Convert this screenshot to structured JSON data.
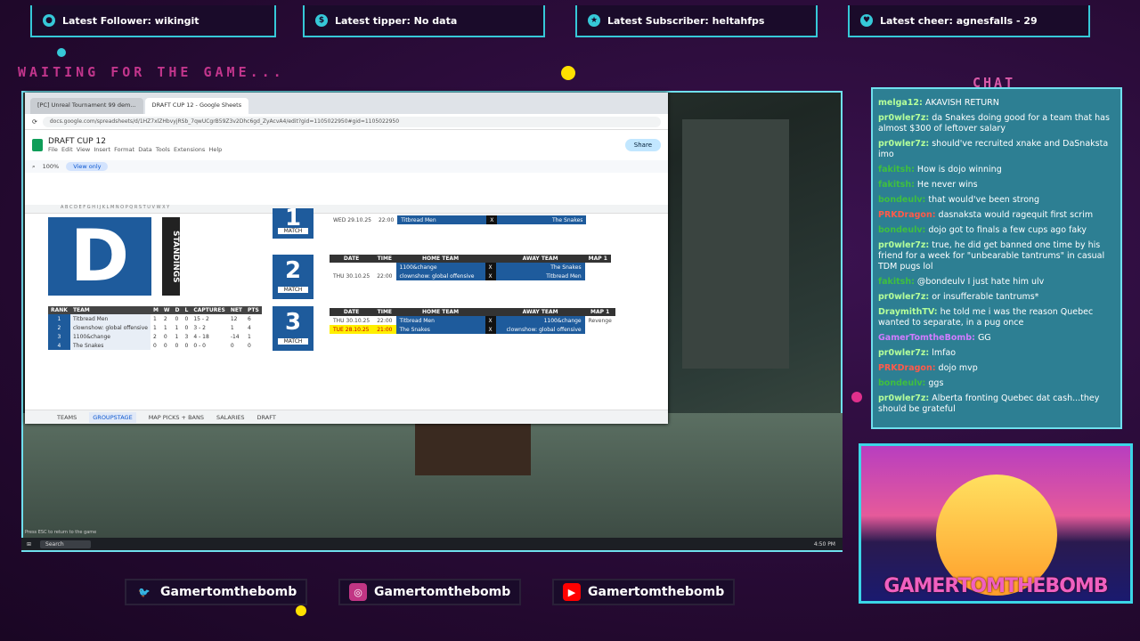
{
  "alerts": {
    "follower": "Latest Follower: wikingit",
    "tipper": "Latest tipper: No data",
    "subscriber": "Latest Subscriber: heltahfps",
    "cheer": "Latest cheer: agnesfalls - 29"
  },
  "waiting": "WAITING FOR THE GAME...",
  "chat": {
    "title": "CHAT",
    "messages": [
      {
        "user": "melga12:",
        "text": "AKAVISH RETURN"
      },
      {
        "user": "pr0wler7z:",
        "text": "da Snakes doing good for a team that has almost $300 of leftover salary"
      },
      {
        "user": "pr0wler7z:",
        "text": "should've recruited xnake and DaSnaksta imo"
      },
      {
        "user": "fakitsh:",
        "text": "How is dojo winning"
      },
      {
        "user": "fakitsh:",
        "text": "He never wins"
      },
      {
        "user": "bondeulv:",
        "text": "that would've been strong"
      },
      {
        "user": "PRKDragon:",
        "text": "dasnaksta would ragequit first scrim"
      },
      {
        "user": "bondeulv:",
        "text": "dojo got to finals a few cups ago faky"
      },
      {
        "user": "pr0wler7z:",
        "text": "true, he did get banned one time by his friend for a week for \"unbearable tantrums\" in casual TDM pugs lol"
      },
      {
        "user": "fakitsh:",
        "text": "@bondeulv I just hate him ulv"
      },
      {
        "user": "pr0wler7z:",
        "text": "or insufferable tantrums*"
      },
      {
        "user": "DraymithTV:",
        "text": "he told me i was the reason Quebec wanted to separate, in a pug once"
      },
      {
        "user": "GamerTomtheBomb:",
        "text": "GG"
      },
      {
        "user": "pr0wler7z:",
        "text": "lmfao"
      },
      {
        "user": "PRKDragon:",
        "text": "dojo mvp"
      },
      {
        "user": "bondeulv:",
        "text": "ggs"
      },
      {
        "user": "pr0wler7z:",
        "text": "Alberta fronting Quebec dat cash...they should be grateful"
      }
    ]
  },
  "browser": {
    "tab1": "[PC] Unreal Tournament 99 dem...",
    "tab2": "DRAFT CUP 12 - Google Sheets",
    "url": "docs.google.com/spreadsheets/d/1HZ7xlZHbvyjRSb_7qwUCgrB59Z3v2Dhc6gd_ZyAcvA4/edit?gid=1105022950#gid=1105022950",
    "doc_title": "DRAFT CUP 12",
    "menu": [
      "File",
      "Edit",
      "View",
      "Insert",
      "Format",
      "Data",
      "Tools",
      "Extensions",
      "Help"
    ],
    "share": "Share",
    "zoom": "100%",
    "view_only": "View only"
  },
  "sheet": {
    "big_letter": "D",
    "standings_label": "STANDINGS",
    "standings_headers": [
      "RANK",
      "TEAM",
      "M",
      "W",
      "D",
      "L",
      "CAPTURES",
      "NET",
      "PTS"
    ],
    "standings": [
      {
        "rank": "1",
        "team": "Titbread Men",
        "m": "1",
        "w": "2",
        "d": "0",
        "l": "0",
        "captures": "15 - 2",
        "net": "12",
        "pts": "6"
      },
      {
        "rank": "2",
        "team": "clownshow: global offensive",
        "m": "1",
        "w": "1",
        "d": "1",
        "l": "0",
        "captures": "3 - 2",
        "net": "1",
        "pts": "4"
      },
      {
        "rank": "3",
        "team": "1100&change",
        "m": "2",
        "w": "0",
        "d": "1",
        "l": "3",
        "captures": "4 - 18",
        "net": "-14",
        "pts": "1"
      },
      {
        "rank": "4",
        "team": "The Snakes",
        "m": "0",
        "w": "0",
        "d": "0",
        "l": "0",
        "captures": "0 - 0",
        "net": "0",
        "pts": "0"
      }
    ],
    "match_word": "MATCH",
    "matches": [
      {
        "num": "1",
        "rows": [
          {
            "date": "WED 29.10.25",
            "time": "22:00",
            "home": "Titbread Men",
            "away": "The Snakes"
          }
        ]
      },
      {
        "num": "2",
        "rows": [
          {
            "date": "THU 30.10.25",
            "time": "22:00",
            "home": "1100&change",
            "away": "The Snakes"
          },
          {
            "date": "",
            "time": "",
            "home": "clownshow: global offensive",
            "away": "Titbread Men"
          }
        ]
      },
      {
        "num": "3",
        "rows": [
          {
            "date": "THU 30.10.25",
            "time": "22:00",
            "home": "Titbread Men",
            "away": "1100&change",
            "map": "Revenge"
          },
          {
            "date": "TUE 28.10.25",
            "time": "21:00",
            "home": "The Snakes",
            "away": "clownshow: global offensive"
          }
        ]
      }
    ],
    "sched_headers": [
      "DATE",
      "TIME",
      "IP",
      "HOME TEAM",
      "",
      "AWAY TEAM",
      "MAP 1"
    ],
    "tabs": [
      "TEAMS",
      "GROUPSTAGE",
      "MAP PICKS + BANS",
      "SALARIES",
      "DRAFT"
    ]
  },
  "taskbar": {
    "search": "Search",
    "time": "4:50 PM",
    "hint": "Press ESC to return to the game"
  },
  "socials": [
    {
      "icon": "twitter-icon",
      "handle": "Gamertomthebomb",
      "color": "#1da1f2"
    },
    {
      "icon": "instagram-icon",
      "handle": "Gamertomthebomb",
      "color": "#c13584"
    },
    {
      "icon": "youtube-icon",
      "handle": "Gamertomthebomb",
      "color": "#ff0000"
    }
  ],
  "cam_name": "GAMERTOMTHEBOMB",
  "colors": {
    "accent": "#36c9d8",
    "panel": "#2d7f93",
    "pink": "#c2358c"
  }
}
